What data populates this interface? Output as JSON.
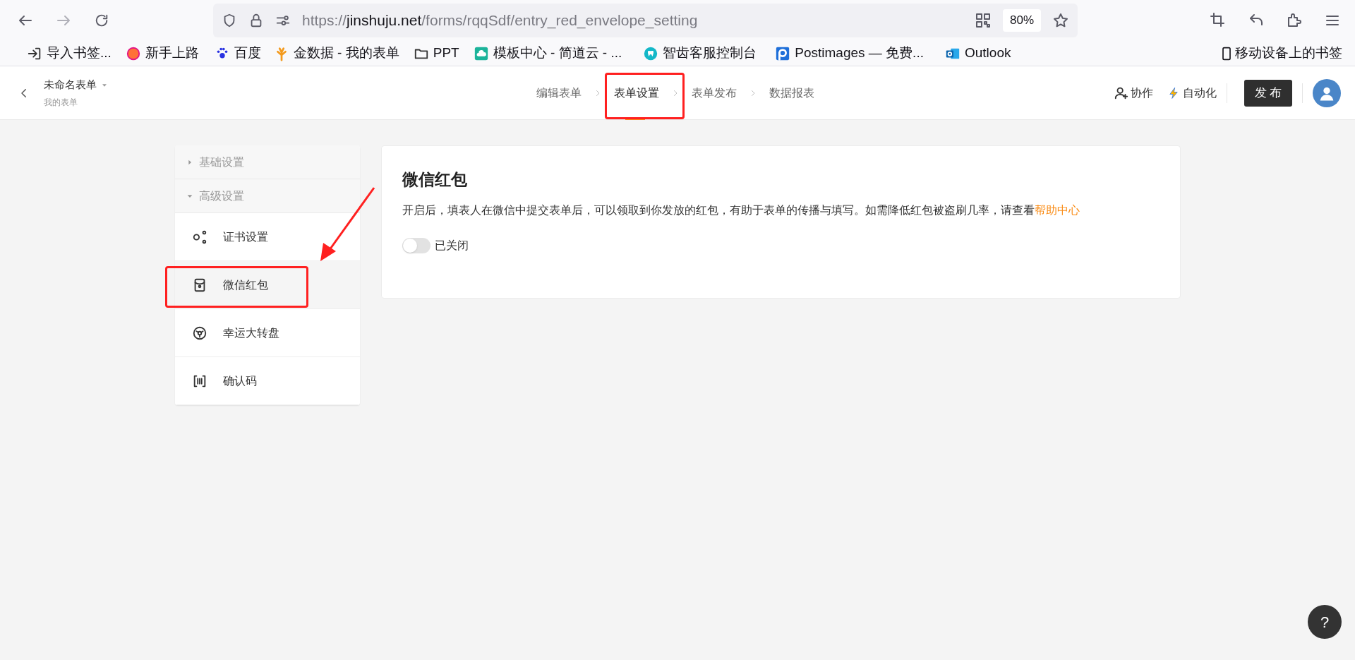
{
  "browser": {
    "url": {
      "scheme": "https://",
      "host": "jinshuju.net",
      "path": "/forms/rqqSdf/entry_red_envelope_setting"
    },
    "zoom": "80%",
    "bookmarks": [
      {
        "kind": "import",
        "label": "导入书签..."
      },
      {
        "kind": "firefox",
        "label": "新手上路"
      },
      {
        "kind": "paw",
        "label": "百度"
      },
      {
        "kind": "tree",
        "label": "金数据 - 我的表单"
      },
      {
        "kind": "folder",
        "label": "PPT"
      },
      {
        "kind": "cloud",
        "label": "模板中心 - 简道云 - ..."
      },
      {
        "kind": "tooth",
        "label": "智齿客服控制台"
      },
      {
        "kind": "p",
        "label": "Postimages — 免费..."
      },
      {
        "kind": "mail",
        "label": "Outlook"
      }
    ],
    "mobile_bookmarks": "移动设备上的书签"
  },
  "header": {
    "form_title": "未命名表单",
    "breadcrumb": "我的表单",
    "steps": [
      {
        "label": "编辑表单",
        "selected": false
      },
      {
        "label": "表单设置",
        "selected": true
      },
      {
        "label": "表单发布",
        "selected": false
      },
      {
        "label": "数据报表",
        "selected": false
      }
    ],
    "collaborate": "协作",
    "automate": "自动化",
    "publish": "发 布"
  },
  "sidebar": {
    "groups": [
      {
        "label": "基础设置",
        "expanded": false
      },
      {
        "label": "高级设置",
        "expanded": true,
        "items": [
          {
            "kind": "cert",
            "label": "证书设置",
            "selected": false
          },
          {
            "kind": "envelope",
            "label": "微信红包",
            "selected": true
          },
          {
            "kind": "wheel",
            "label": "幸运大转盘",
            "selected": false
          },
          {
            "kind": "code",
            "label": "确认码",
            "selected": false
          }
        ]
      }
    ]
  },
  "card": {
    "title": "微信红包",
    "description": "开启后，填表人在微信中提交表单后，可以领取到你发放的红包，有助于表单的传播与填写。如需降低红包被盗刷几率，请查看",
    "link": "帮助中心",
    "toggle": {
      "on": false,
      "label": "已关闭"
    }
  },
  "help_button": "?"
}
